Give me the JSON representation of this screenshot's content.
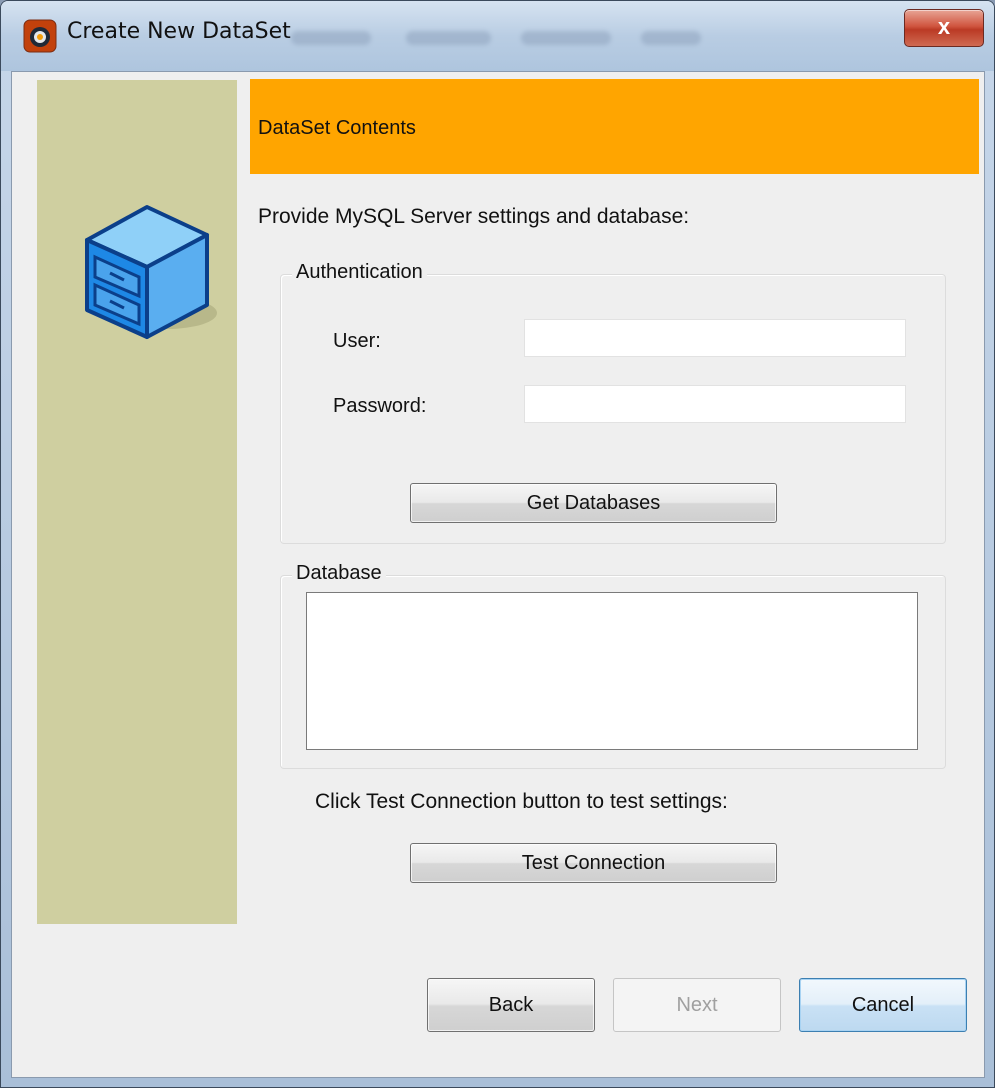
{
  "window": {
    "title": "Create New DataSet",
    "close_symbol": "x",
    "icon": "app-logo-icon"
  },
  "side_panel": {
    "illustration": "file-cabinet-icon",
    "color": "#cfcfa0"
  },
  "header": {
    "title": "DataSet Contents",
    "color": "#ffa500"
  },
  "instructions": "Provide MySQL Server settings and database:",
  "authentication": {
    "legend": "Authentication",
    "user_label": "User:",
    "user_value": "",
    "password_label": "Password:",
    "password_value": "",
    "get_databases_label": "Get Databases"
  },
  "database": {
    "legend": "Database",
    "items": []
  },
  "test": {
    "hint": "Click Test Connection button to test settings:",
    "button_label": "Test Connection"
  },
  "footer": {
    "back_label": "Back",
    "next_label": "Next",
    "cancel_label": "Cancel"
  }
}
